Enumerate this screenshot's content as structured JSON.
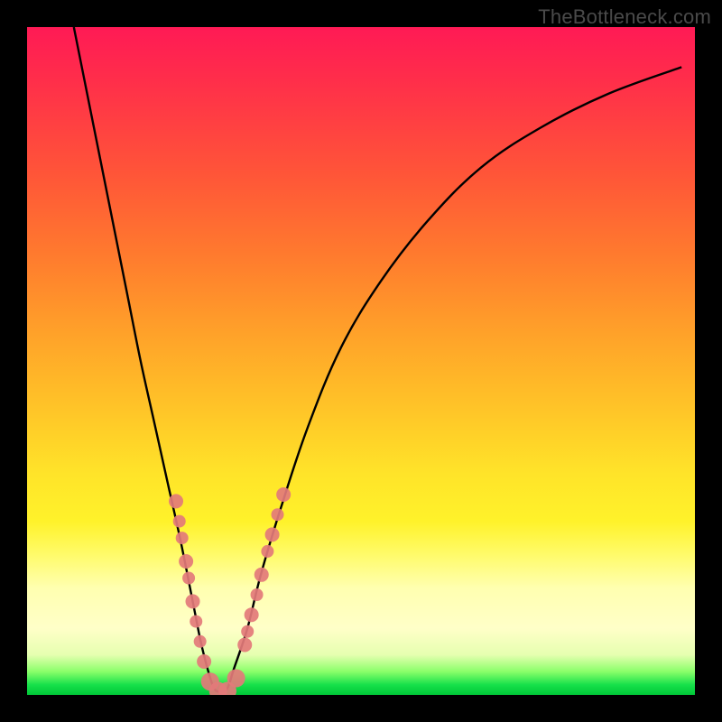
{
  "watermark": "TheBottleneck.com",
  "chart_data": {
    "type": "line",
    "title": "",
    "xlabel": "",
    "ylabel": "",
    "xlim": [
      0,
      100
    ],
    "ylim": [
      0,
      100
    ],
    "series": [
      {
        "name": "bottleneck-curve",
        "x": [
          7,
          9,
          11,
          13,
          15,
          17,
          19,
          21,
          23,
          25,
          26,
          27,
          28,
          29,
          30,
          31,
          33,
          35,
          38,
          42,
          47,
          53,
          60,
          68,
          77,
          87,
          98
        ],
        "y": [
          100,
          90,
          80,
          70,
          60,
          50,
          41,
          32,
          23,
          13,
          8,
          4,
          1,
          0.5,
          1,
          4,
          10,
          18,
          28,
          40,
          52,
          62,
          71,
          79,
          85,
          90,
          94
        ]
      }
    ],
    "markers": {
      "name": "highlighted-points",
      "color": "#e37a7a",
      "points": [
        {
          "x": 22.3,
          "y": 29.0,
          "r": 8
        },
        {
          "x": 22.8,
          "y": 26.0,
          "r": 7
        },
        {
          "x": 23.2,
          "y": 23.5,
          "r": 7
        },
        {
          "x": 23.8,
          "y": 20.0,
          "r": 8
        },
        {
          "x": 24.2,
          "y": 17.5,
          "r": 7
        },
        {
          "x": 24.8,
          "y": 14.0,
          "r": 8
        },
        {
          "x": 25.3,
          "y": 11.0,
          "r": 7
        },
        {
          "x": 25.9,
          "y": 8.0,
          "r": 7
        },
        {
          "x": 26.5,
          "y": 5.0,
          "r": 8
        },
        {
          "x": 27.4,
          "y": 2.0,
          "r": 10
        },
        {
          "x": 28.6,
          "y": 0.6,
          "r": 10
        },
        {
          "x": 30.0,
          "y": 0.6,
          "r": 10
        },
        {
          "x": 31.3,
          "y": 2.5,
          "r": 10
        },
        {
          "x": 32.6,
          "y": 7.5,
          "r": 8
        },
        {
          "x": 33.0,
          "y": 9.5,
          "r": 7
        },
        {
          "x": 33.6,
          "y": 12.0,
          "r": 8
        },
        {
          "x": 34.4,
          "y": 15.0,
          "r": 7
        },
        {
          "x": 35.1,
          "y": 18.0,
          "r": 8
        },
        {
          "x": 36.0,
          "y": 21.5,
          "r": 7
        },
        {
          "x": 36.7,
          "y": 24.0,
          "r": 8
        },
        {
          "x": 37.5,
          "y": 27.0,
          "r": 7
        },
        {
          "x": 38.4,
          "y": 30.0,
          "r": 8
        }
      ]
    }
  }
}
